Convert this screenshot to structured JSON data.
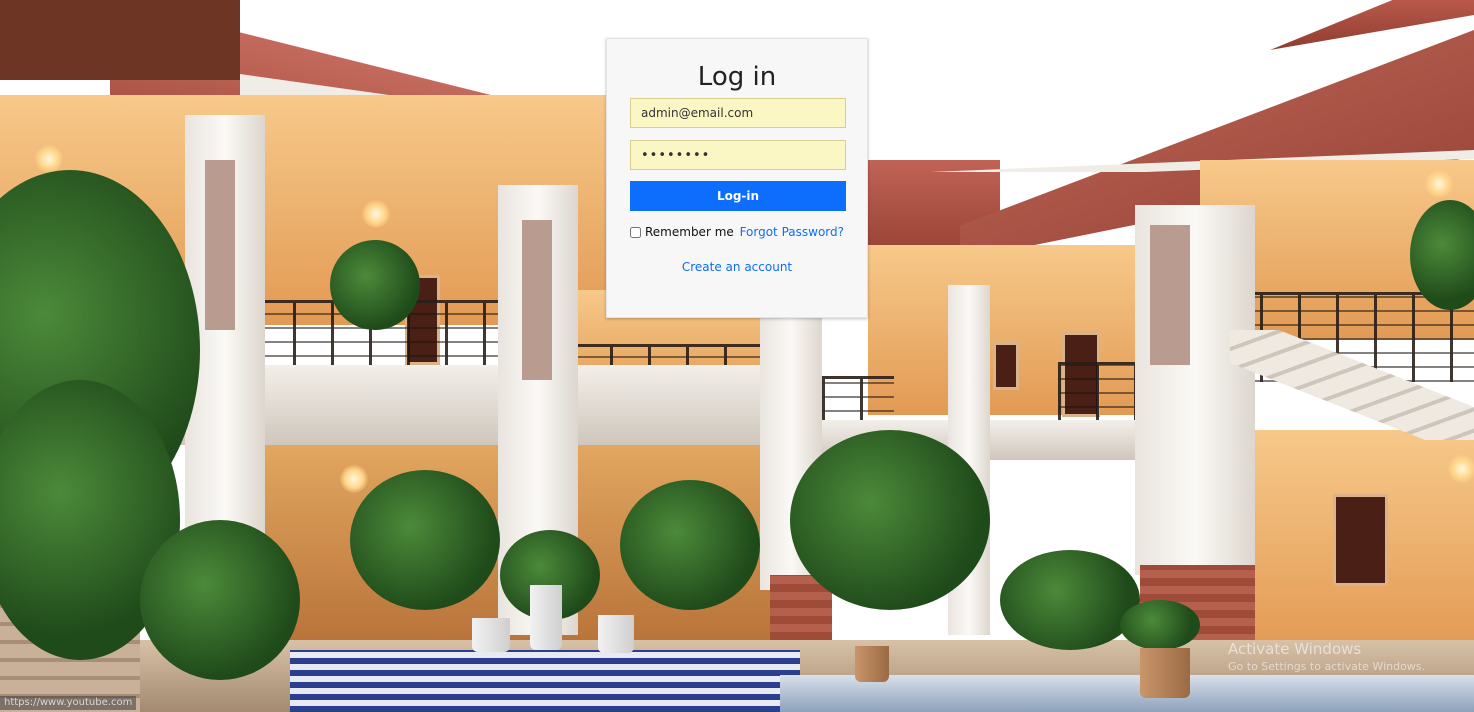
{
  "login": {
    "title": "Log in",
    "email_value": "admin@email.com",
    "password_value": "••••••••",
    "submit_label": "Log-in",
    "remember_label": "Remember me",
    "remember_checked": false,
    "forgot_label": "Forgot Password?",
    "create_account_label": "Create an account"
  },
  "background": {
    "description_icon": "hotel-courtyard-photo"
  },
  "overlay": {
    "watermark_title": "Activate Windows",
    "watermark_sub": "Go to Settings to activate Windows.",
    "status_url": "https://www.youtube.com"
  },
  "colors": {
    "primary": "#0d6efd",
    "card_bg": "#f7f7f7",
    "autofill_bg": "#fbf7c4"
  }
}
